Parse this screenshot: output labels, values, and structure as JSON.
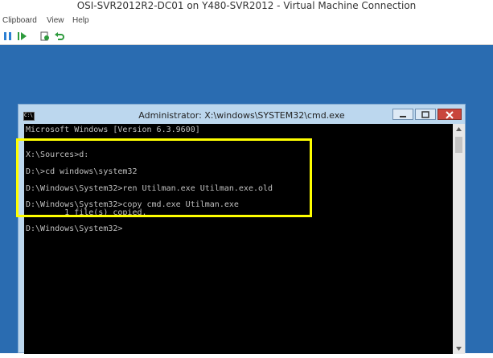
{
  "window": {
    "title": "OSI-SVR2012R2-DC01 on Y480-SVR2012 - Virtual Machine Connection"
  },
  "menu": {
    "items": [
      "Clipboard",
      "View",
      "Help"
    ]
  },
  "toolbar": {
    "icons": [
      "pause-icon",
      "start-icon",
      "checkpoint-icon",
      "revert-icon"
    ]
  },
  "cmd": {
    "title": "Administrator: X:\\windows\\SYSTEM32\\cmd.exe",
    "lines": [
      "Microsoft Windows [Version 6.3.9600]",
      "",
      "X:\\Sources>d:",
      "",
      "D:\\>cd windows\\system32",
      "",
      "D:\\Windows\\System32>ren Utilman.exe Utilman.exe.old",
      "",
      "D:\\Windows\\System32>copy cmd.exe Utilman.exe",
      "        1 file(s) copied.",
      "",
      "D:\\Windows\\System32>"
    ]
  },
  "colors": {
    "desktop": "#2a6cb1",
    "highlight": "#ffff00",
    "console_bg": "#000000",
    "console_text": "#c0c0c0"
  }
}
